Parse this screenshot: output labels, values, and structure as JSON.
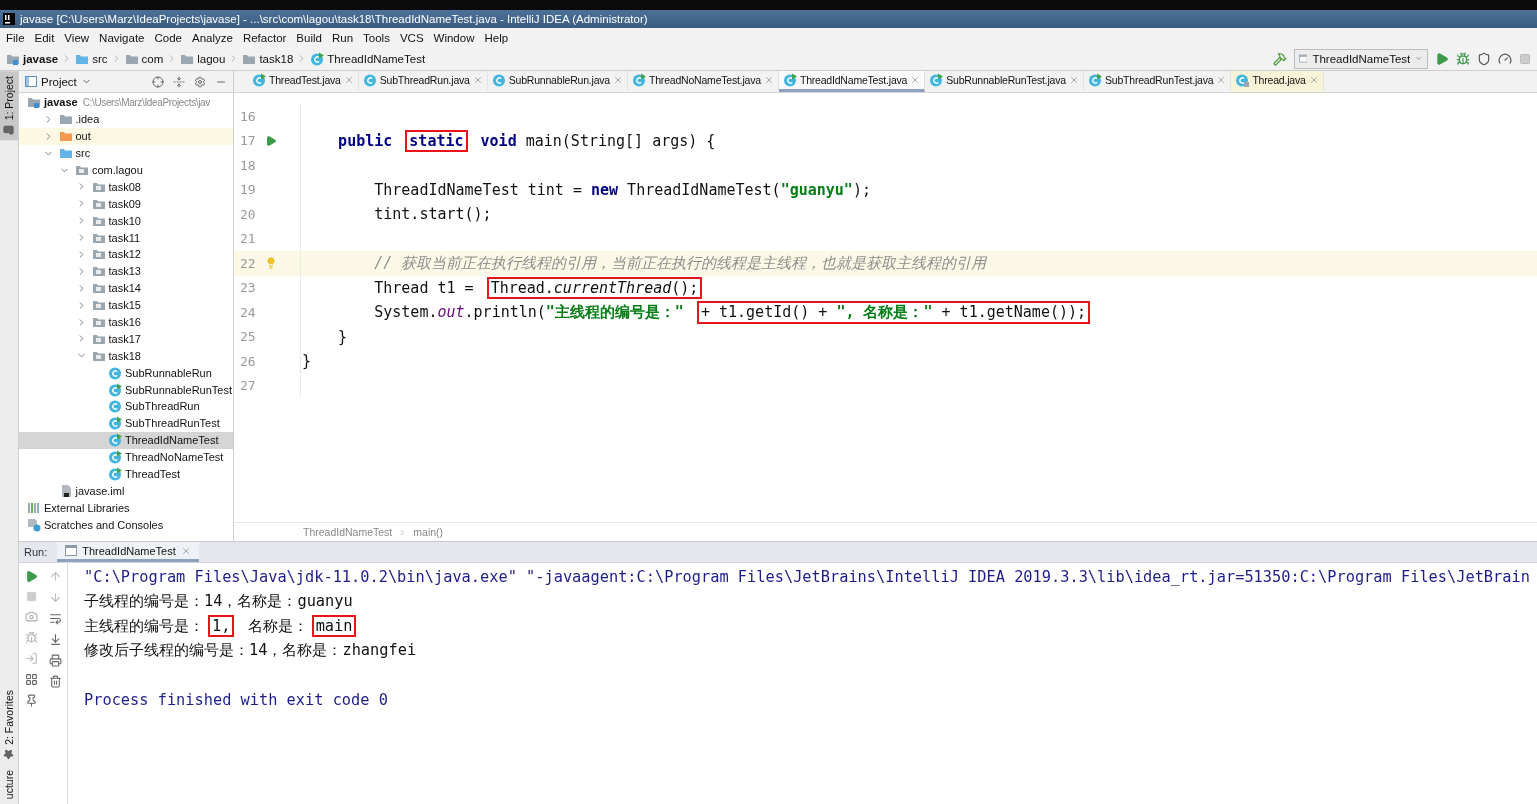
{
  "window": {
    "title": "javase [C:\\Users\\Marz\\IdeaProjects\\javase] - ...\\src\\com\\lagou\\task18\\ThreadIdNameTest.java - IntelliJ IDEA (Administrator)"
  },
  "menu": [
    "File",
    "Edit",
    "View",
    "Navigate",
    "Code",
    "Analyze",
    "Refactor",
    "Build",
    "Run",
    "Tools",
    "VCS",
    "Window",
    "Help"
  ],
  "breadcrumbs": [
    {
      "label": "javase",
      "kind": "module"
    },
    {
      "label": "src",
      "kind": "source"
    },
    {
      "label": "com",
      "kind": "folder"
    },
    {
      "label": "lagou",
      "kind": "folder"
    },
    {
      "label": "task18",
      "kind": "folder"
    },
    {
      "label": "ThreadIdNameTest",
      "kind": "runnable"
    }
  ],
  "run_config": {
    "label": "ThreadIdNameTest"
  },
  "tool_windows": {
    "top": [
      {
        "label": "1: Project",
        "kind": "folder",
        "selected": true
      }
    ],
    "bottom": [
      {
        "label": "2: Favorites",
        "kind": "star",
        "selected": false
      },
      {
        "label": "ucture",
        "kind": "plain",
        "selected": false
      }
    ]
  },
  "project_panel": {
    "title": "Project",
    "tree": [
      {
        "label": "javase",
        "detail": "C:\\Users\\Marz\\IdeaProjects\\jav",
        "kind": "module",
        "selected": false,
        "children": [
          {
            "label": ".idea",
            "kind": "folder",
            "expanded": false,
            "selected": false
          },
          {
            "label": "out",
            "kind": "excluded",
            "expanded": false,
            "selected": false
          },
          {
            "label": "src",
            "kind": "source",
            "expanded": true,
            "selected": false,
            "children": [
              {
                "label": "com.lagou",
                "kind": "package",
                "expanded": true,
                "selected": false,
                "children": [
                  {
                    "label": "task08",
                    "kind": "package",
                    "expanded": false,
                    "selected": false
                  },
                  {
                    "label": "task09",
                    "kind": "package",
                    "expanded": false,
                    "selected": false
                  },
                  {
                    "label": "task10",
                    "kind": "package",
                    "expanded": false,
                    "selected": false
                  },
                  {
                    "label": "task11",
                    "kind": "package",
                    "expanded": false,
                    "selected": false
                  },
                  {
                    "label": "task12",
                    "kind": "package",
                    "expanded": false,
                    "selected": false
                  },
                  {
                    "label": "task13",
                    "kind": "package",
                    "expanded": false,
                    "selected": false
                  },
                  {
                    "label": "task14",
                    "kind": "package",
                    "expanded": false,
                    "selected": false
                  },
                  {
                    "label": "task15",
                    "kind": "package",
                    "expanded": false,
                    "selected": false
                  },
                  {
                    "label": "task16",
                    "kind": "package",
                    "expanded": false,
                    "selected": false
                  },
                  {
                    "label": "task17",
                    "kind": "package",
                    "expanded": false,
                    "selected": false
                  },
                  {
                    "label": "task18",
                    "kind": "package",
                    "expanded": true,
                    "selected": false,
                    "children": [
                      {
                        "label": "SubRunnableRun",
                        "kind": "class",
                        "selected": false
                      },
                      {
                        "label": "SubRunnableRunTest",
                        "kind": "runnable",
                        "selected": false
                      },
                      {
                        "label": "SubThreadRun",
                        "kind": "class",
                        "selected": false
                      },
                      {
                        "label": "SubThreadRunTest",
                        "kind": "runnable",
                        "selected": false
                      },
                      {
                        "label": "ThreadIdNameTest",
                        "kind": "runnable",
                        "selected": true
                      },
                      {
                        "label": "ThreadNoNameTest",
                        "kind": "runnable",
                        "selected": false
                      },
                      {
                        "label": "ThreadTest",
                        "kind": "runnable",
                        "selected": false
                      }
                    ]
                  }
                ]
              }
            ]
          },
          {
            "label": "javase.iml",
            "kind": "iml",
            "selected": false
          }
        ]
      },
      {
        "label": "External Libraries",
        "kind": "libraries",
        "selected": false
      },
      {
        "label": "Scratches and Consoles",
        "kind": "scratches",
        "selected": false
      }
    ]
  },
  "tabs": [
    {
      "label": "ThreadTest.java",
      "kind": "runnable",
      "selected": false
    },
    {
      "label": "SubThreadRun.java",
      "kind": "class",
      "selected": false
    },
    {
      "label": "SubRunnableRun.java",
      "kind": "class",
      "selected": false
    },
    {
      "label": "ThreadNoNameTest.java",
      "kind": "runnable",
      "selected": false
    },
    {
      "label": "ThreadIdNameTest.java",
      "kind": "runnable",
      "selected": true
    },
    {
      "label": "SubRunnableRunTest.java",
      "kind": "runnable",
      "selected": false
    },
    {
      "label": "SubThreadRunTest.java",
      "kind": "runnable",
      "selected": false
    },
    {
      "label": "Thread.java",
      "kind": "library",
      "selected": false
    }
  ],
  "editor": {
    "lines": [
      {
        "number": "16",
        "kind": "plain",
        "current": false
      },
      {
        "number": "17",
        "kind": "run",
        "current": false,
        "segments": [
          {
            "text": "    public ",
            "kind": "keyword",
            "boxed": false
          },
          {
            "text": "static",
            "kind": "keyword",
            "boxed": true
          },
          {
            "text": " void",
            "kind": "keyword",
            "boxed": false
          },
          {
            "text": " main(String[] args) {",
            "kind": "plain",
            "boxed": false
          }
        ]
      },
      {
        "number": "18",
        "kind": "plain",
        "current": false
      },
      {
        "number": "19",
        "kind": "plain",
        "current": false,
        "segments": [
          {
            "text": "        ThreadIdNameTest tint = ",
            "kind": "plain",
            "boxed": false
          },
          {
            "text": "new",
            "kind": "keyword",
            "boxed": false
          },
          {
            "text": " ThreadIdNameTest(",
            "kind": "plain",
            "boxed": false
          },
          {
            "text": "\"guanyu\"",
            "kind": "string",
            "boxed": false
          },
          {
            "text": ");",
            "kind": "plain",
            "boxed": false
          }
        ]
      },
      {
        "number": "20",
        "kind": "plain",
        "current": false,
        "segments": [
          {
            "text": "        tint.start();",
            "kind": "plain",
            "boxed": false
          }
        ]
      },
      {
        "number": "21",
        "kind": "plain",
        "current": false
      },
      {
        "number": "22",
        "kind": "bulb",
        "current": true,
        "segments": [
          {
            "text": "        // 获取当前正在执行线程的引用，当前正在执行的线程是主线程，也就是获取主线程的引用",
            "kind": "comment",
            "boxed": false
          }
        ]
      },
      {
        "number": "23",
        "kind": "plain",
        "current": false,
        "segments": [
          {
            "text": "        Thread t1 = ",
            "kind": "plain",
            "boxed": false
          },
          {
            "text": "Thread.",
            "kind": "plain",
            "boxed": true
          },
          {
            "text": "currentThread",
            "kind": "method",
            "boxed": true
          },
          {
            "text": "();",
            "kind": "plain",
            "boxed": true
          }
        ]
      },
      {
        "number": "24",
        "kind": "plain",
        "current": false,
        "segments": [
          {
            "text": "        System.",
            "kind": "plain",
            "boxed": false
          },
          {
            "text": "out",
            "kind": "field",
            "boxed": false
          },
          {
            "text": ".println(",
            "kind": "plain",
            "boxed": false
          },
          {
            "text": "\"主线程的编号是：\" ",
            "kind": "string",
            "boxed": false
          },
          {
            "text": "+ t1.getId() + ",
            "kind": "plain",
            "boxed": true
          },
          {
            "text": "\", 名称是：\"",
            "kind": "string",
            "boxed": true
          },
          {
            "text": " + t1.getName());",
            "kind": "plain",
            "boxed": true
          }
        ]
      },
      {
        "number": "25",
        "kind": "plain",
        "current": false,
        "segments": [
          {
            "text": "    }",
            "kind": "plain",
            "boxed": false
          }
        ]
      },
      {
        "number": "26",
        "kind": "plain",
        "current": false,
        "segments": [
          {
            "text": "}",
            "kind": "plain",
            "boxed": false
          }
        ]
      },
      {
        "number": "27",
        "kind": "plain",
        "current": false
      }
    ],
    "breadcrumb": [
      "ThreadIdNameTest",
      "main()"
    ]
  },
  "run_panel": {
    "label": "Run:",
    "tab": {
      "label": "ThreadIdNameTest",
      "selected": true
    },
    "console": [
      {
        "kind": "command",
        "segments": [
          {
            "text": "\"C:\\Program Files\\Java\\jdk-11.0.2\\bin\\java.exe\" \"-javaagent:C:\\Program Files\\JetBrains\\IntelliJ IDEA 2019.3.3\\lib\\idea_rt.jar=51350:C:\\Program Files\\JetBrain",
            "boxed": false
          }
        ]
      },
      {
        "kind": "output",
        "segments": [
          {
            "text": "子线程的编号是：14，名称是：guanyu",
            "boxed": false
          }
        ]
      },
      {
        "kind": "output",
        "segments": [
          {
            "text": "主线程的编号是：",
            "boxed": false
          },
          {
            "text": "1,",
            "boxed": true
          },
          {
            "text": " 名称是：",
            "boxed": false
          },
          {
            "text": "main",
            "boxed": true
          }
        ]
      },
      {
        "kind": "output",
        "segments": [
          {
            "text": "修改后子线程的编号是：14，名称是：zhangfei",
            "boxed": false
          }
        ]
      },
      {
        "kind": "blank"
      },
      {
        "kind": "exit",
        "segments": [
          {
            "text": "Process finished with exit code 0",
            "boxed": false
          }
        ]
      }
    ]
  }
}
